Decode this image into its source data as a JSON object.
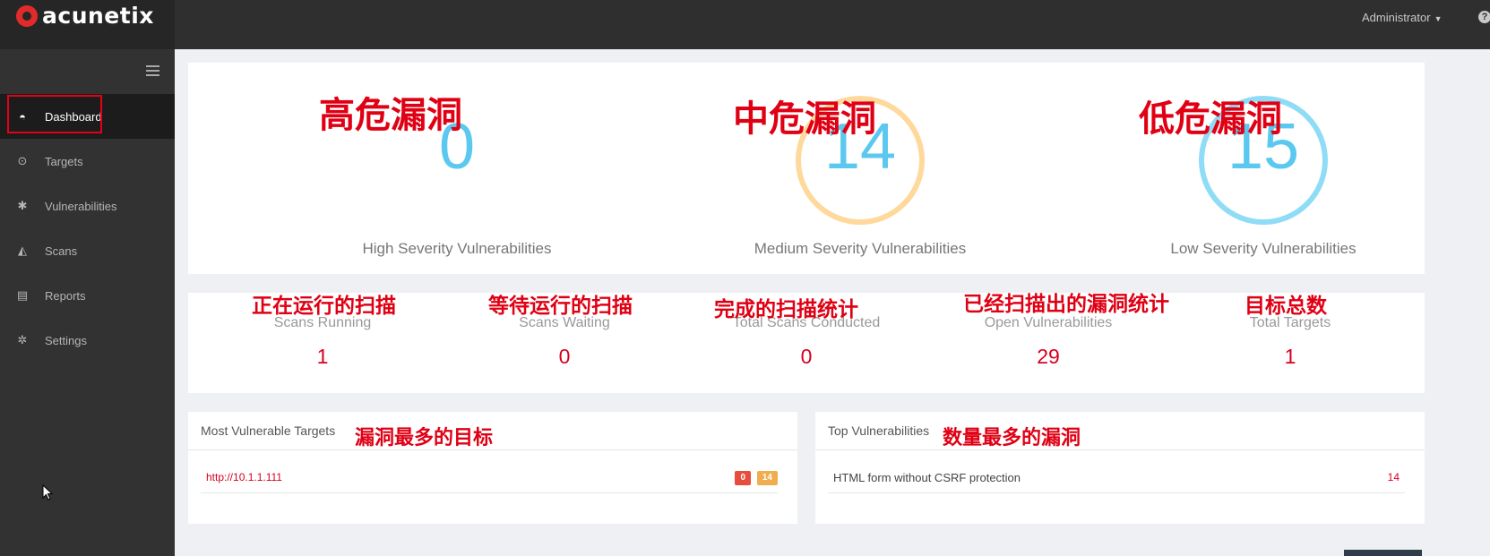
{
  "app": {
    "logo_text": "acunetix",
    "user": "Administrator",
    "help_glyph": "?"
  },
  "sidebar": {
    "items": [
      {
        "label": "Dashboard",
        "icon": "dashboard-icon",
        "glyph": "◓",
        "active": true
      },
      {
        "label": "Targets",
        "icon": "target-icon",
        "glyph": "⊙"
      },
      {
        "label": "Vulnerabilities",
        "icon": "bug-icon",
        "glyph": "✱"
      },
      {
        "label": "Scans",
        "icon": "area-chart-icon",
        "glyph": "◭"
      },
      {
        "label": "Reports",
        "icon": "file-icon",
        "glyph": "▤"
      },
      {
        "label": "Settings",
        "icon": "gear-icon",
        "glyph": "✲"
      }
    ]
  },
  "severity": {
    "high": {
      "value": "0",
      "label": "High Severity Vulnerabilities",
      "annotation": "高危漏洞",
      "ring_color": ""
    },
    "medium": {
      "value": "14",
      "label": "Medium Severity Vulnerabilities",
      "annotation": "中危漏洞",
      "ring_color": "#ffd89c"
    },
    "low": {
      "value": "15",
      "label": "Low Severity Vulnerabilities",
      "annotation": "低危漏洞",
      "ring_color": "#8fdcf7"
    }
  },
  "stats": [
    {
      "label": "Scans Running",
      "value": "1",
      "annotation": "正在运行的扫描"
    },
    {
      "label": "Scans Waiting",
      "value": "0",
      "annotation": "等待运行的扫描"
    },
    {
      "label": "Total Scans Conducted",
      "value": "0",
      "annotation": "完成的扫描统计"
    },
    {
      "label": "Open Vulnerabilities",
      "value": "29",
      "annotation": "已经扫描出的漏洞统计"
    },
    {
      "label": "Total Targets",
      "value": "1",
      "annotation": "目标总数"
    }
  ],
  "most_vulnerable": {
    "title": "Most Vulnerable Targets",
    "annotation": "漏洞最多的目标",
    "rows": [
      {
        "url": "http://10.1.1.111",
        "high": "0",
        "medium": "14"
      }
    ]
  },
  "top_vulnerabilities": {
    "title": "Top Vulnerabilities",
    "annotation": "数量最多的漏洞",
    "rows": [
      {
        "name": "HTML form without CSRF protection",
        "count": "14"
      }
    ]
  },
  "colors": {
    "accent_red": "#d8001f",
    "high_badge": "#e74c3c",
    "medium_badge": "#f0ad4e",
    "number_blue": "#5bc8f0"
  }
}
